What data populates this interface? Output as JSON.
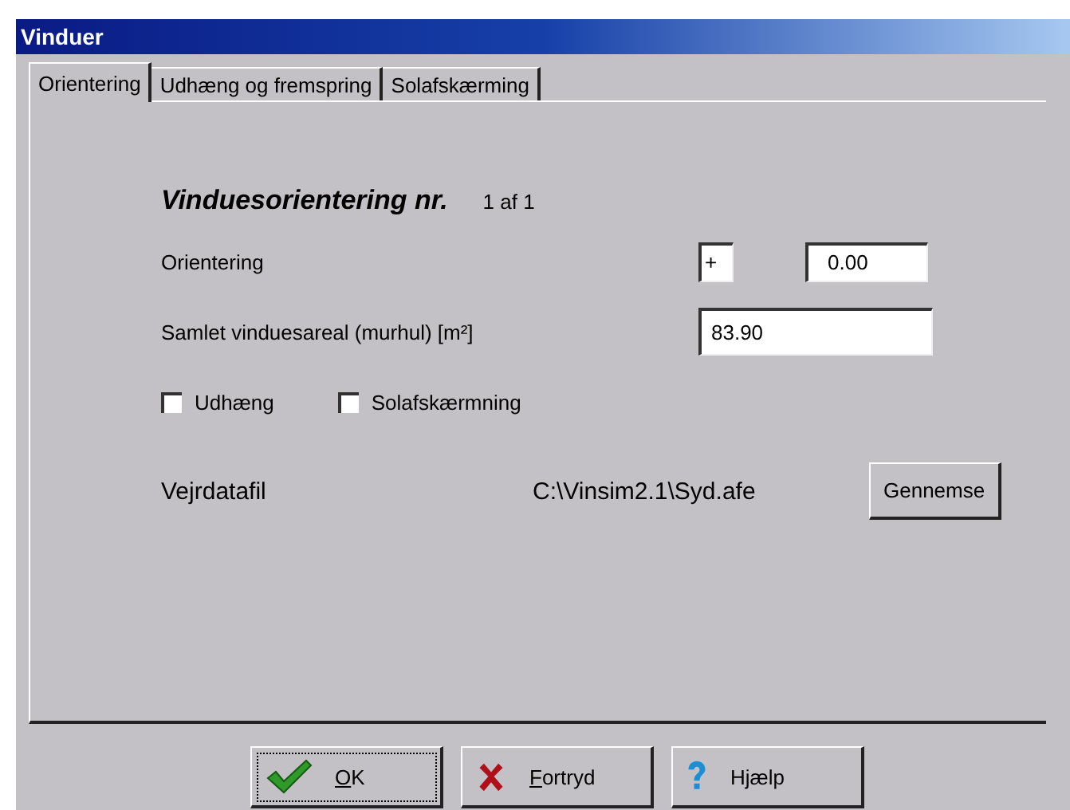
{
  "window": {
    "title": "Vinduer"
  },
  "tabs": [
    {
      "label": "Orientering",
      "selected": true
    },
    {
      "label": "Udhæng og fremspring",
      "selected": false
    },
    {
      "label": "Solafskærming",
      "selected": false
    }
  ],
  "heading": {
    "title": "Vinduesorientering nr.",
    "counter": "1 af 1"
  },
  "orientation": {
    "label": "Orientering",
    "sign": "+",
    "value": "0.00"
  },
  "area": {
    "label": "Samlet vinduesareal (murhul) [m²]",
    "value": "83.90"
  },
  "checkboxes": [
    {
      "label": "Udhæng",
      "checked": false
    },
    {
      "label": "Solafskærmning",
      "checked": false
    }
  ],
  "weather": {
    "label": "Vejrdatafil",
    "path": "C:\\Vinsim2.1\\Syd.afe",
    "button": "Gennemse"
  },
  "buttons": [
    {
      "kind": "ok",
      "label": "OK",
      "mnemonic": true
    },
    {
      "kind": "cancel",
      "label": "Fortryd",
      "mnemonic": true
    },
    {
      "kind": "help",
      "label": "Hjælp",
      "mnemonic": false
    }
  ]
}
